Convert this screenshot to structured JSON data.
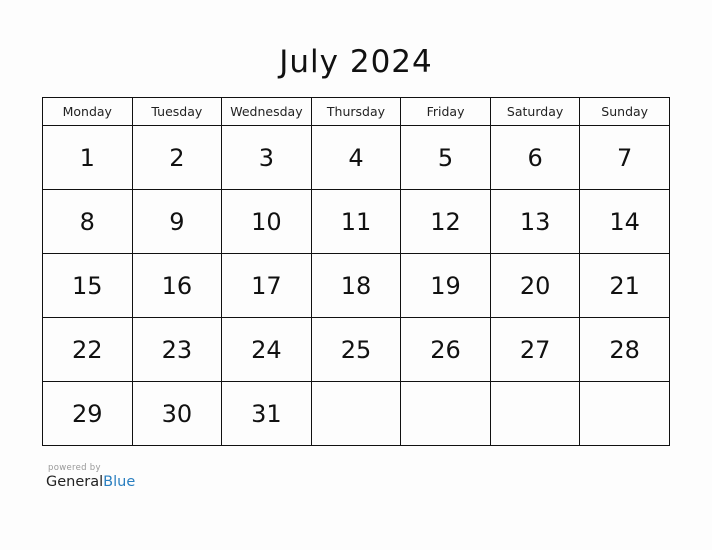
{
  "title": "July 2024",
  "weekdays": [
    "Monday",
    "Tuesday",
    "Wednesday",
    "Thursday",
    "Friday",
    "Saturday",
    "Sunday"
  ],
  "weeks": [
    [
      "1",
      "2",
      "3",
      "4",
      "5",
      "6",
      "7"
    ],
    [
      "8",
      "9",
      "10",
      "11",
      "12",
      "13",
      "14"
    ],
    [
      "15",
      "16",
      "17",
      "18",
      "19",
      "20",
      "21"
    ],
    [
      "22",
      "23",
      "24",
      "25",
      "26",
      "27",
      "28"
    ],
    [
      "29",
      "30",
      "31",
      "",
      "",
      "",
      ""
    ]
  ],
  "footer": {
    "powered_by": "powered by",
    "brand_general": "General",
    "brand_blue": "Blue",
    "brand_blue_color": "#2a7fc0"
  }
}
